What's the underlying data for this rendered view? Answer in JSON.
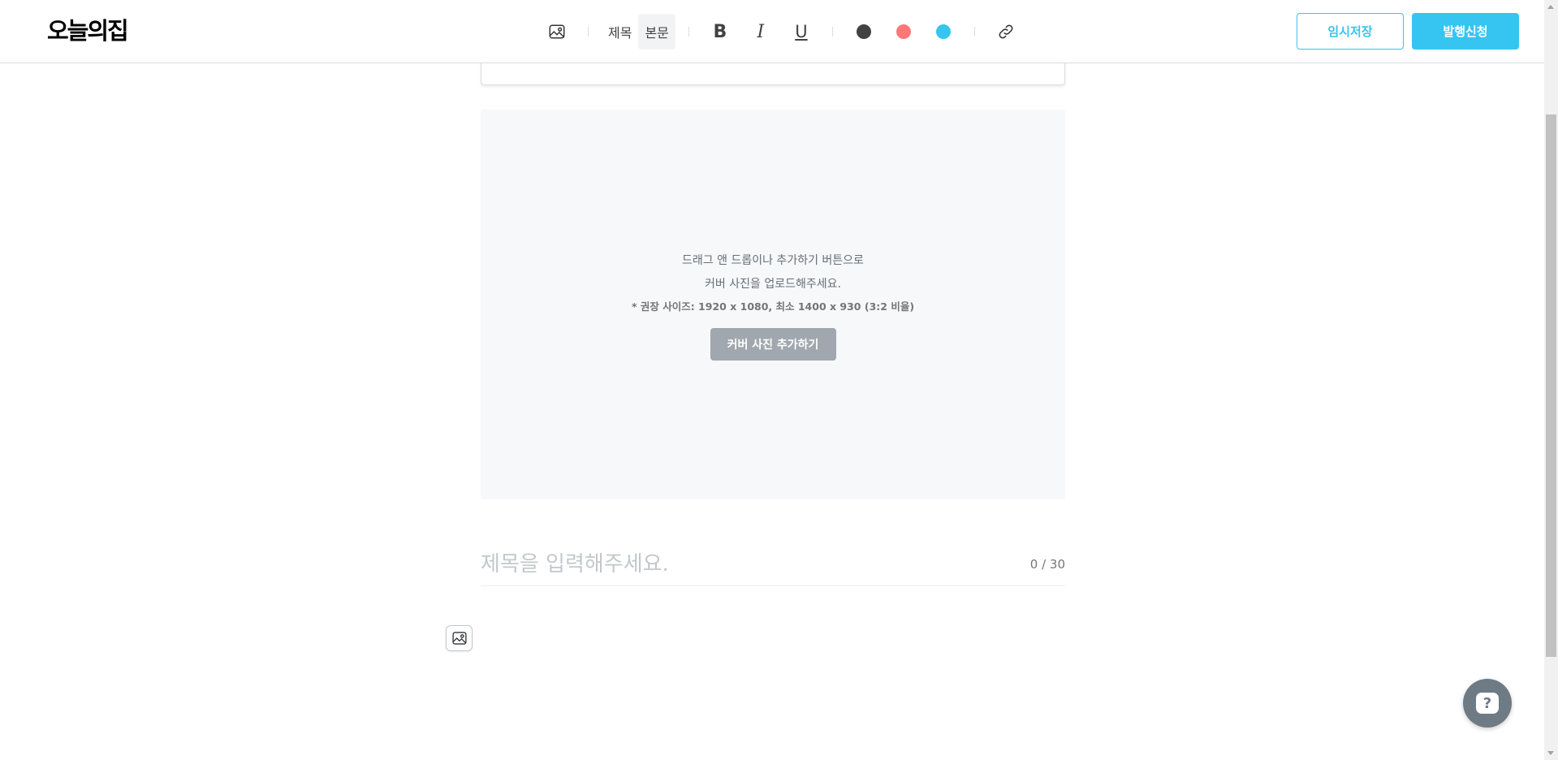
{
  "header": {
    "logo": "오늘의집",
    "toolbar": {
      "heading_label": "제목",
      "body_label": "본문",
      "bold_label": "B",
      "italic_label": "I",
      "underline_label": "U",
      "colors": [
        "#424242",
        "#f77",
        "#35c5f0"
      ]
    },
    "save_label": "임시저장",
    "publish_label": "발행신청"
  },
  "cover": {
    "line1": "드래그 앤 드롭이나 추가하기 버튼으로",
    "line2": "커버 사진을 업로드해주세요.",
    "note": "* 권장 사이즈: 1920 x 1080, 최소 1400 x 930 (3:2 비율)",
    "button_label": "커버 사진 추가하기"
  },
  "title": {
    "placeholder": "제목을 입력해주세요.",
    "counter": "0 / 30"
  },
  "help": {
    "label": "?"
  }
}
